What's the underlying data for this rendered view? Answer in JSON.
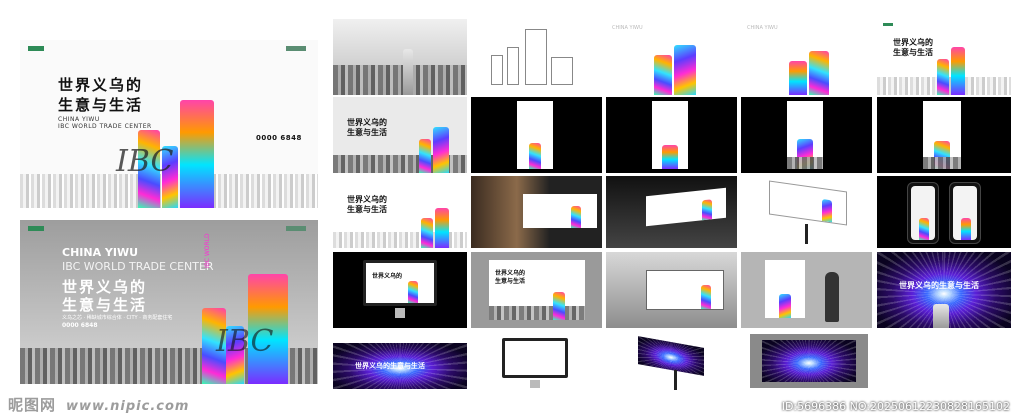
{
  "hero_top": {
    "title_line1": "世界义乌的",
    "title_line2": "生意与生活",
    "subtitle_en1": "CHINA YIWU",
    "subtitle_en2": "IBC WORLD TRADE CENTER",
    "phone": "0000 6848",
    "signature": "IBC"
  },
  "hero_bottom": {
    "en_line1": "CHINA YIWU",
    "en_line2": "IBC WORLD TRADE CENTER",
    "title_line1": "世界义乌的",
    "title_line2": "生意与生活",
    "vertical_tag1": "IBC WORLD",
    "vertical_tag2": "TRADE CENTER",
    "caption": "义乌之芯 · 稀缺城市综合体 · CITY · 商务配套住宅",
    "phone": "0000 6848",
    "signature": "IBC"
  },
  "thumbnails": {
    "panel_title_en1": "CHINA YIWU",
    "panel_title_en2": "IBC WORLD TRADE CENTER",
    "slogan_line1": "世界义乌的",
    "slogan_line2": "生意与生活",
    "slogan_inline": "世界义乌的生意与生活"
  },
  "watermark": {
    "brand": "昵图网",
    "url": "www.nipic.com",
    "id": "ID:5696386 NO:20250612230828165102"
  },
  "colors": {
    "accent_pink": "#ff2bd6",
    "accent_cyan": "#31e3ff",
    "accent_violet": "#5b3dff",
    "brand_green": "#2e8b57"
  }
}
